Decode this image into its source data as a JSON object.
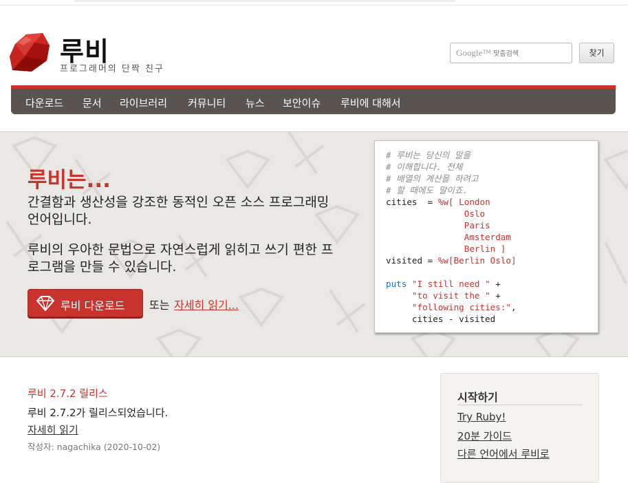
{
  "header": {
    "title": "루비",
    "subtitle": "프로그래머의 단짝 친구",
    "search": {
      "placeholder_brand": "Google™",
      "placeholder_text": "맞춤검색",
      "button_label": "찾기"
    }
  },
  "nav": {
    "items": [
      "다운로드",
      "문서",
      "라이브러리",
      "커뮤니티",
      "뉴스",
      "보안이슈",
      "루비에 대해서"
    ]
  },
  "hero": {
    "title": "루비는...",
    "paragraph1": "간결함과 생산성을 강조한 동적인 오픈 소스 프로그래밍 언어입니다.",
    "paragraph2": "루비의 우아한 문법으로 자연스럽게 읽히고 쓰기 편한 프로그램을 만들 수 있습니다.",
    "download_label": "루비 다운로드",
    "or_text": "또는",
    "more_link": "자세히 읽기..."
  },
  "code": {
    "lines": [
      [
        {
          "t": "# 루비는 당신의 말을",
          "c": "comment"
        }
      ],
      [
        {
          "t": "# 이해합니다. 전체",
          "c": "comment"
        }
      ],
      [
        {
          "t": "# 배열의 계산을 하려고",
          "c": "comment"
        }
      ],
      [
        {
          "t": "# 할 때에도 말이죠.",
          "c": "comment"
        }
      ],
      [
        {
          "t": "cities  = ",
          "c": "plain"
        },
        {
          "t": "%w[ London",
          "c": "str"
        }
      ],
      [
        {
          "t": "               Oslo",
          "c": "str"
        }
      ],
      [
        {
          "t": "               Paris",
          "c": "str"
        }
      ],
      [
        {
          "t": "               Amsterdam",
          "c": "str"
        }
      ],
      [
        {
          "t": "               Berlin ]",
          "c": "str"
        }
      ],
      [
        {
          "t": "visited = ",
          "c": "plain"
        },
        {
          "t": "%w[Berlin Oslo]",
          "c": "str"
        }
      ],
      [
        {
          "t": "",
          "c": "plain"
        }
      ],
      [
        {
          "t": "puts ",
          "c": "kw"
        },
        {
          "t": "\"I still need \"",
          "c": "str"
        },
        {
          "t": " +",
          "c": "plain"
        }
      ],
      [
        {
          "t": "     ",
          "c": "plain"
        },
        {
          "t": "\"to visit the \"",
          "c": "str"
        },
        {
          "t": " +",
          "c": "plain"
        }
      ],
      [
        {
          "t": "     ",
          "c": "plain"
        },
        {
          "t": "\"following cities:\"",
          "c": "str"
        },
        {
          "t": ",",
          "c": "plain"
        }
      ],
      [
        {
          "t": "     cities - visited",
          "c": "plain"
        }
      ]
    ]
  },
  "news": {
    "title": "루비 2.7.2 릴리스",
    "body": "루비 2.7.2가 릴리스되었습니다.",
    "link": "자세히 읽기",
    "meta": "작성자: nagachika (2020-10-02)"
  },
  "sidebar": {
    "title": "시작하기",
    "links": [
      "Try Ruby!",
      "20분 가이드",
      "다른 언어에서 루비로"
    ]
  },
  "colors": {
    "brand_red": "#c8332d",
    "nav_bg": "#5a5450",
    "hero_bg": "#eae8e4"
  }
}
